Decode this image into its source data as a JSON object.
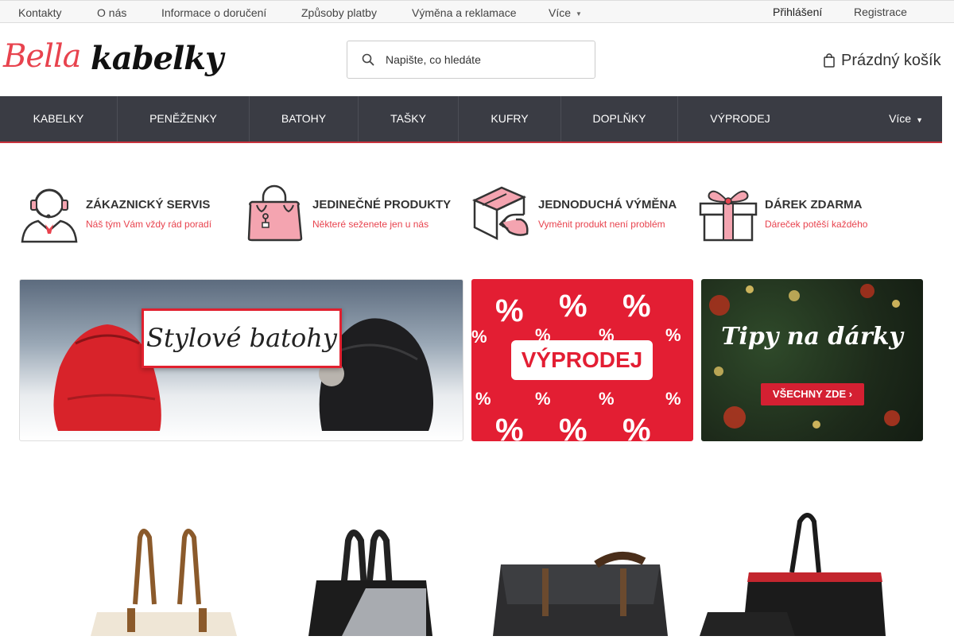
{
  "topbar": {
    "links": [
      "Kontakty",
      "O nás",
      "Informace o doručení",
      "Způsoby platby",
      "Výměna a reklamace",
      "Více"
    ],
    "login": "Přihlášení",
    "register": "Registrace"
  },
  "logo": {
    "part1": "Bella",
    "part2": "kabelky"
  },
  "search": {
    "placeholder": "Napište, co hledáte"
  },
  "cart": {
    "label": "Prázdný košík"
  },
  "nav": {
    "items": [
      "KABELKY",
      "PENĚŽENKY",
      "BATOHY",
      "TAŠKY",
      "KUFRY",
      "DOPLŇKY",
      "VÝPRODEJ"
    ],
    "more": "Více"
  },
  "features": [
    {
      "title": "ZÁKAZNICKÝ SERVIS",
      "subtitle": "Náš tým Vám vždy rád poradí",
      "icon": "customer-service-icon"
    },
    {
      "title": "JEDINEČNÉ PRODUKTY",
      "subtitle": "Některé seženete jen u nás",
      "icon": "handbag-icon"
    },
    {
      "title": "JEDNODUCHÁ VÝMĚNA",
      "subtitle": "Vyměnit produkt není problém",
      "icon": "return-box-icon"
    },
    {
      "title": "DÁREK ZDARMA",
      "subtitle": "Dáreček potěší každého",
      "icon": "gift-icon"
    }
  ],
  "banners": {
    "backpacks": "Stylové batohy",
    "sale": "VÝPRODEJ",
    "sale_symbol": "%",
    "gifts": "Tipy na dárky",
    "gifts_cta": "VŠECHNY ZDE ›"
  },
  "colors": {
    "accent": "#e8434e",
    "nav_bg": "#3a3c44",
    "sale_red": "#e31e33"
  }
}
